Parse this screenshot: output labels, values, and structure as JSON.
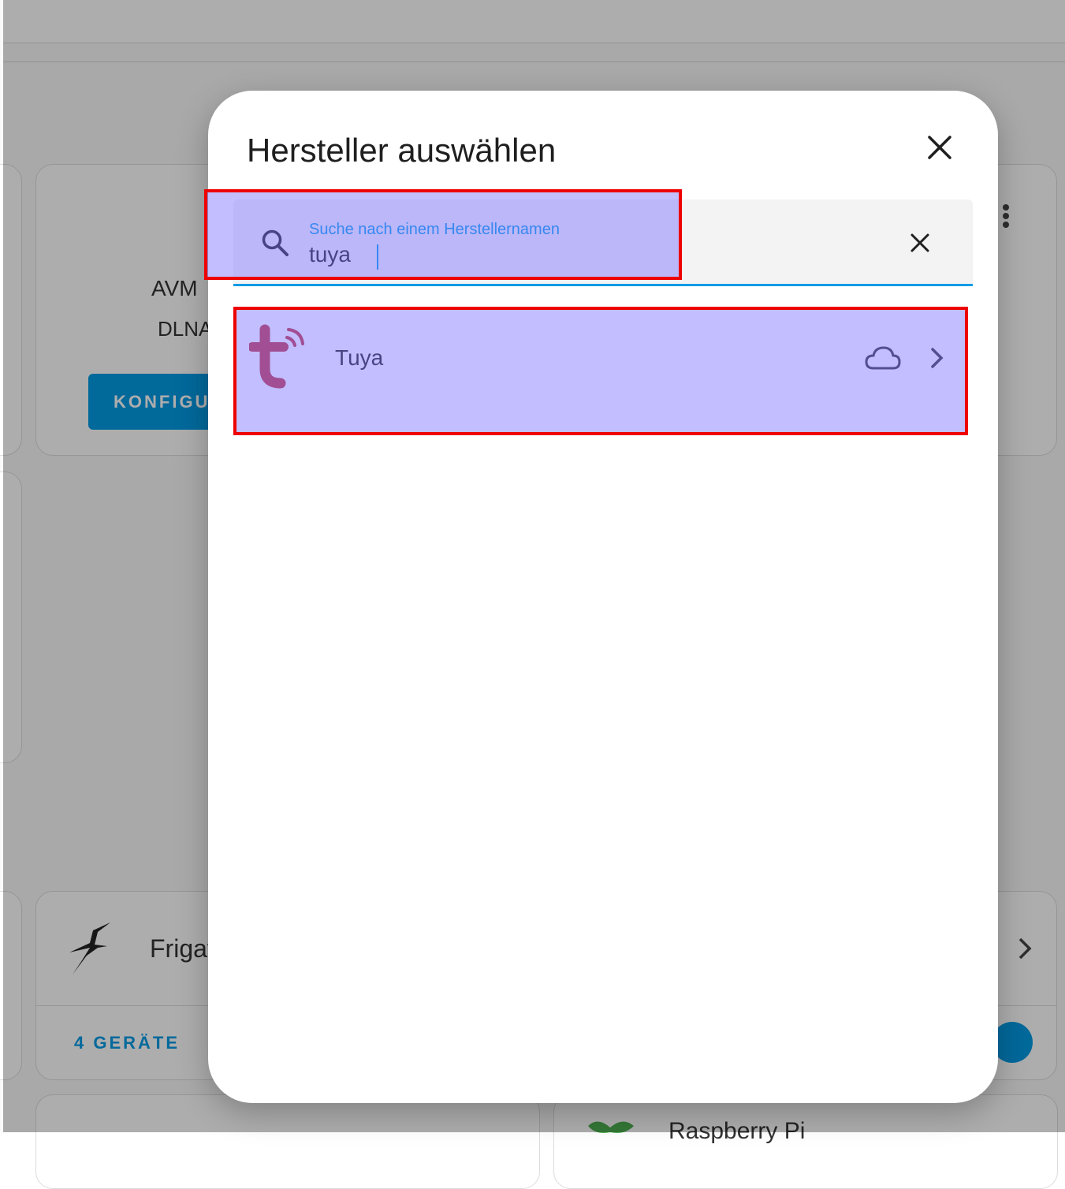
{
  "background": {
    "card_brand": "AVM",
    "card_integration": "DLNA",
    "configure_label": "KONFIGURIEREN",
    "frigate_label": "Frigate",
    "devices_label": "4 GERÄTE",
    "raspberry_label": "Raspberry Pi"
  },
  "dialog": {
    "title": "Hersteller auswählen",
    "search": {
      "label": "Suche nach einem Herstellernamen",
      "value": "tuya"
    },
    "results": [
      {
        "name": "Tuya",
        "icon": "tuya-logo",
        "badge_icon": "cloud-icon"
      }
    ]
  },
  "colors": {
    "accent": "#039be5",
    "tuya_red": "#c4343c",
    "highlight_border": "#ee0000",
    "highlight_fill": "#bdbbfb"
  }
}
